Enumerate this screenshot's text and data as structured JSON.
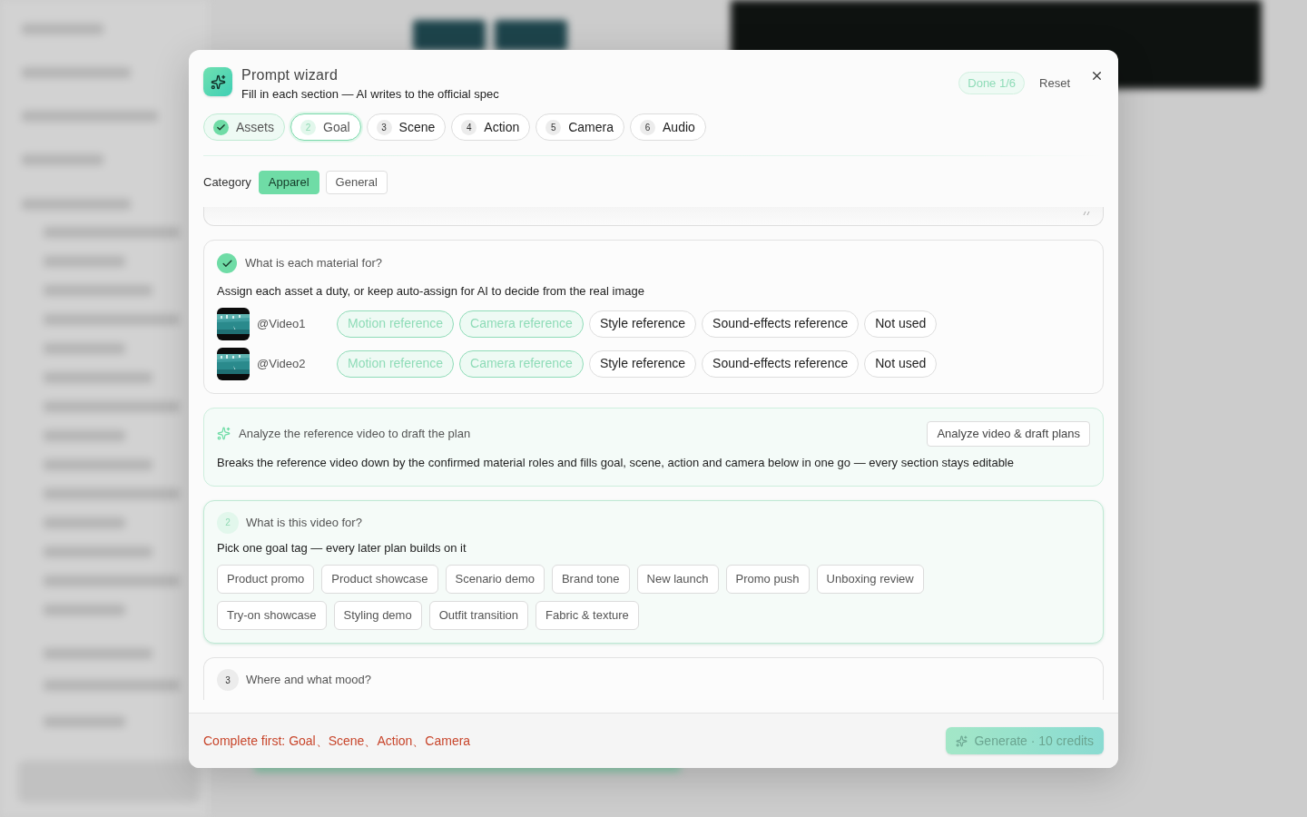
{
  "dialog": {
    "title": "Prompt wizard",
    "subtitle": "Fill in each section — AI writes to the official spec",
    "progress": "Done 1/6",
    "reset": "Reset"
  },
  "steps": [
    {
      "label": "Assets",
      "done": true,
      "selected": false
    },
    {
      "number": "2",
      "label": "Goal",
      "done": false,
      "selected": true
    },
    {
      "number": "3",
      "label": "Scene",
      "done": false,
      "selected": false
    },
    {
      "number": "4",
      "label": "Action",
      "done": false,
      "selected": false
    },
    {
      "number": "5",
      "label": "Camera",
      "done": false,
      "selected": false
    },
    {
      "number": "6",
      "label": "Audio",
      "done": false,
      "selected": false
    }
  ],
  "category": {
    "label": "Category",
    "options": [
      {
        "label": "Apparel",
        "selected": true
      },
      {
        "label": "General",
        "selected": false
      }
    ]
  },
  "materials": {
    "title": "What is each material for?",
    "done": true,
    "description": "Assign each asset a duty, or keep auto-assign for AI to decide from the real image",
    "assets": [
      {
        "name": "@Video1",
        "roles": [
          {
            "label": "Motion reference",
            "selected": true
          },
          {
            "label": "Camera reference",
            "selected": true
          },
          {
            "label": "Style reference",
            "selected": false
          },
          {
            "label": "Sound-effects reference",
            "selected": false
          },
          {
            "label": "Not used",
            "selected": false
          }
        ]
      },
      {
        "name": "@Video2",
        "roles": [
          {
            "label": "Motion reference",
            "selected": true
          },
          {
            "label": "Camera reference",
            "selected": true
          },
          {
            "label": "Style reference",
            "selected": false
          },
          {
            "label": "Sound-effects reference",
            "selected": false
          },
          {
            "label": "Not used",
            "selected": false
          }
        ]
      }
    ]
  },
  "analyze": {
    "title": "Analyze the reference video to draft the plan",
    "button": "Analyze video & draft plans",
    "description": "Breaks the reference video down by the confirmed material roles and fills goal, scene, action and camera below in one go — every section stays editable"
  },
  "goal": {
    "number": "2",
    "title": "What is this video for?",
    "description": "Pick one goal tag — every later plan builds on it",
    "tag_rows": [
      [
        {
          "label": "Product promo",
          "selected": false
        },
        {
          "label": "Product showcase",
          "selected": false
        },
        {
          "label": "Scenario demo",
          "selected": false
        },
        {
          "label": "Brand tone",
          "selected": false
        },
        {
          "label": "New launch",
          "selected": false
        },
        {
          "label": "Promo push",
          "selected": false
        },
        {
          "label": "Unboxing review",
          "selected": false
        }
      ],
      [
        {
          "label": "Try-on showcase",
          "selected": false
        },
        {
          "label": "Styling demo",
          "selected": false
        },
        {
          "label": "Outfit transition",
          "selected": false
        },
        {
          "label": "Fabric & texture",
          "selected": false
        }
      ]
    ]
  },
  "scene": {
    "number": "3",
    "title": "Where and what mood?"
  },
  "footer": {
    "warning": "Complete first: Goal、Scene、Action、Camera",
    "generate": "Generate · 10 credits",
    "disabled": true
  }
}
